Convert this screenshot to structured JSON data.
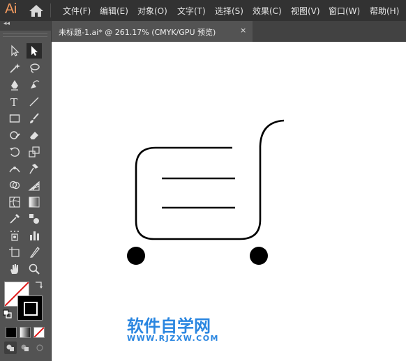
{
  "app": {
    "logo": "Ai"
  },
  "menu": [
    "文件(F)",
    "编辑(E)",
    "对象(O)",
    "文字(T)",
    "选择(S)",
    "效果(C)",
    "视图(V)",
    "窗口(W)",
    "帮助(H)"
  ],
  "document_tab": {
    "title": "未标题-1.ai* @ 261.17% (CMYK/GPU 预览)",
    "close": "×"
  },
  "toolbar": {
    "collapse_label": "◂◂"
  },
  "watermark": {
    "title": "软件自学网",
    "url": "WWW.RJZXW.COM"
  },
  "colors": {
    "menubar": "#323232",
    "panel": "#535353",
    "canvas": "#ffffff",
    "logo": "#f29a5f",
    "watermark": "#2a86e0"
  }
}
